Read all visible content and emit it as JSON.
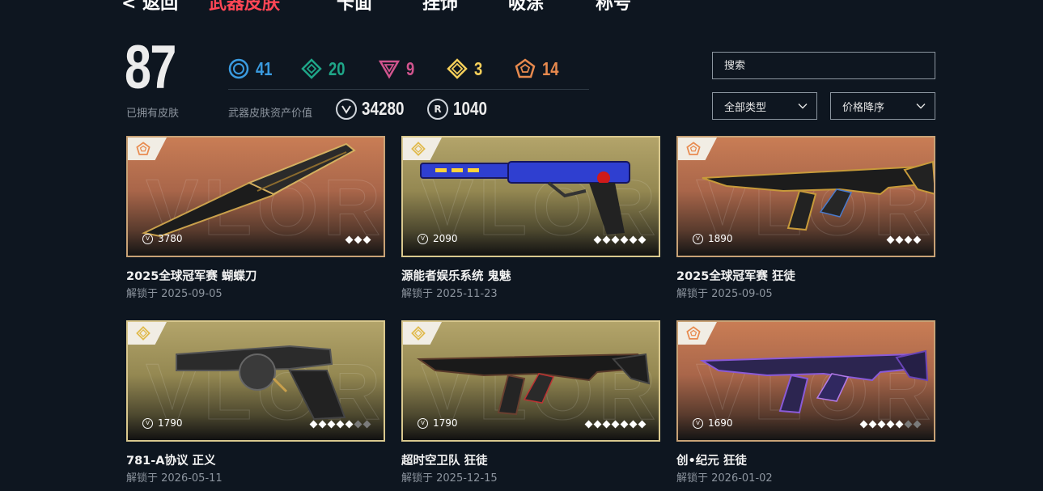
{
  "nav": {
    "items": [
      {
        "label": "< 返回",
        "active": false
      },
      {
        "label": "武器皮肤",
        "active": true
      },
      {
        "label": "卡面",
        "active": false
      },
      {
        "label": "挂饰",
        "active": false
      },
      {
        "label": "吸涂",
        "active": false
      },
      {
        "label": "称号",
        "active": false
      }
    ]
  },
  "stats": {
    "owned_count": "87",
    "owned_label": "已拥有皮肤",
    "tiers": [
      {
        "icon": "select-tier-icon",
        "count": "41",
        "color": "#3a9be0"
      },
      {
        "icon": "deluxe-tier-icon",
        "count": "20",
        "color": "#1fa688"
      },
      {
        "icon": "premium-tier-icon",
        "count": "9",
        "color": "#d1548e"
      },
      {
        "icon": "ultra-tier-icon",
        "count": "3",
        "color": "#f5cf5a"
      },
      {
        "icon": "exclusive-tier-icon",
        "count": "14",
        "color": "#e88a4e"
      }
    ],
    "asset_label": "武器皮肤资产价值",
    "vp_value": "34280",
    "rp_value": "1040",
    "rp_letter": "R"
  },
  "controls": {
    "search_placeholder": "搜索",
    "type_filter": "全部类型",
    "sort": "价格降序"
  },
  "cards": [
    {
      "name": "2025全球冠军赛 蝴蝶刀",
      "unlock": "解锁于 2025-09-05",
      "price": "3780",
      "tier": "exclusive",
      "levels": 3,
      "levels_unlocked": 3,
      "weapon": "knife"
    },
    {
      "name": "源能者娱乐系统 鬼魅",
      "unlock": "解锁于 2025-11-23",
      "price": "2090",
      "tier": "ultra",
      "levels": 6,
      "levels_unlocked": 6,
      "weapon": "pistol"
    },
    {
      "name": "2025全球冠军赛 狂徒",
      "unlock": "解锁于 2025-09-05",
      "price": "1890",
      "tier": "exclusive",
      "levels": 4,
      "levels_unlocked": 4,
      "weapon": "rifle-gold"
    },
    {
      "name": "781-A协议 正义",
      "unlock": "解锁于 2026-05-11",
      "price": "1790",
      "tier": "ultra",
      "levels": 7,
      "levels_unlocked": 5,
      "weapon": "revolver"
    },
    {
      "name": "超时空卫队 狂徒",
      "unlock": "解锁于 2025-12-15",
      "price": "1790",
      "tier": "ultra",
      "levels": 7,
      "levels_unlocked": 7,
      "weapon": "rifle-dark"
    },
    {
      "name": "创•纪元 狂徒",
      "unlock": "解锁于 2026-01-02",
      "price": "1690",
      "tier": "exclusive",
      "levels": 7,
      "levels_unlocked": 5,
      "weapon": "rifle-purple"
    }
  ]
}
